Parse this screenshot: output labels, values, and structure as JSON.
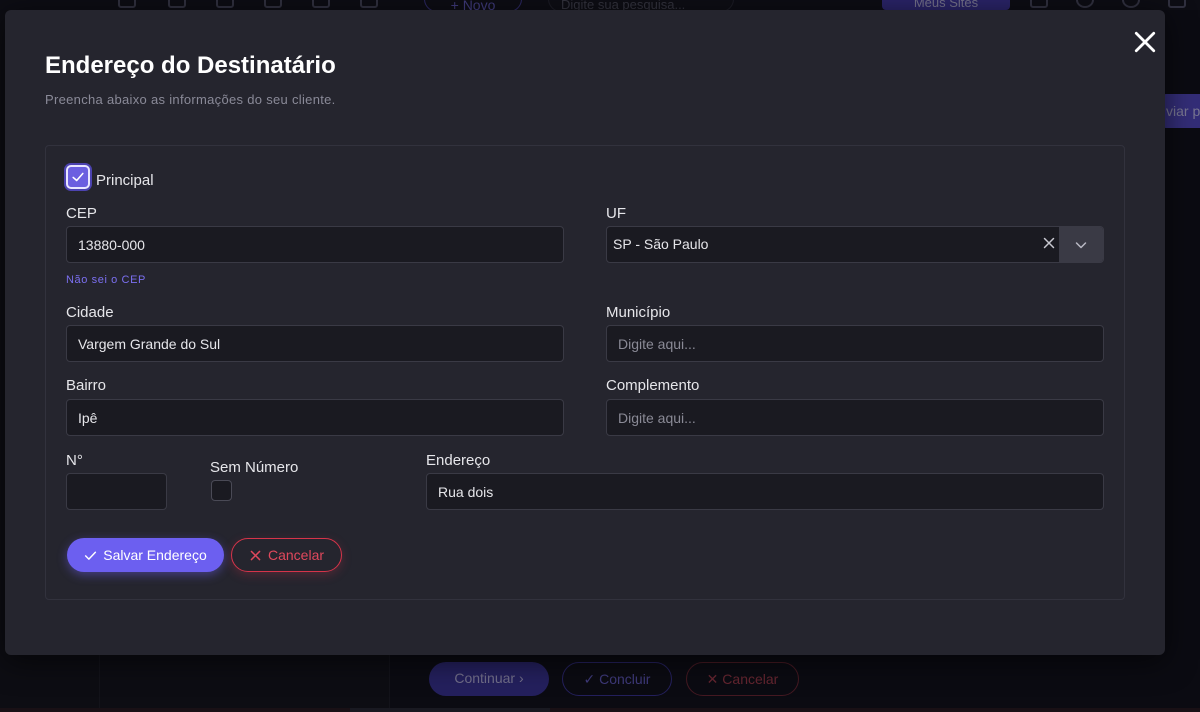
{
  "background": {
    "topbar": {
      "novo_label": "+ Novo",
      "search_placeholder": "Digite sua pesquisa...",
      "sites_label": "Meus Sites"
    },
    "side_button_label": "viar p",
    "bottom_buttons": {
      "continuar": "Continuar ›",
      "concluir": "✓ Concluir",
      "cancelar": "✕ Cancelar"
    }
  },
  "modal": {
    "title": "Endereço do Destinatário",
    "subtitle": "Preencha abaixo as informações do seu cliente.",
    "principal": {
      "label": "Principal",
      "checked": true
    },
    "cep": {
      "label": "CEP",
      "value": "13880-000",
      "link": "Não sei o CEP"
    },
    "uf": {
      "label": "UF",
      "value": "SP - São Paulo"
    },
    "cidade": {
      "label": "Cidade",
      "value": "Vargem Grande do Sul"
    },
    "municipio": {
      "label": "Município",
      "placeholder": "Digite aqui..."
    },
    "bairro": {
      "label": "Bairro",
      "value": "Ipê"
    },
    "complemento": {
      "label": "Complemento",
      "placeholder": "Digite aqui..."
    },
    "numero": {
      "label": "N°",
      "value": ""
    },
    "sem_numero": {
      "label": "Sem Número",
      "checked": false
    },
    "endereco": {
      "label": "Endereço",
      "value": "Rua dois"
    },
    "buttons": {
      "salvar": "Salvar Endereço",
      "cancelar": "Cancelar"
    }
  },
  "colors": {
    "accent": "#6c5ff0",
    "danger": "#d6344a",
    "modal_bg": "#25252e",
    "input_bg": "#1a1a21"
  }
}
